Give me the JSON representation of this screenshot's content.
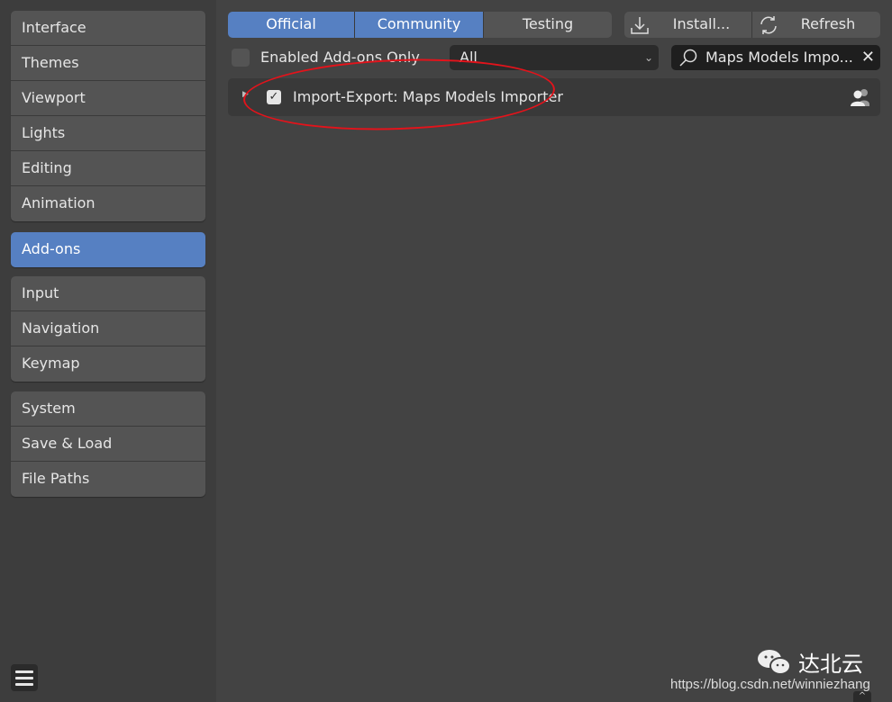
{
  "sidebar": {
    "groups": [
      [
        "Interface",
        "Themes",
        "Viewport",
        "Lights",
        "Editing",
        "Animation"
      ],
      [
        "Add-ons"
      ],
      [
        "Input",
        "Navigation",
        "Keymap"
      ],
      [
        "System",
        "Save & Load",
        "File Paths"
      ]
    ],
    "active": "Add-ons"
  },
  "tabs": {
    "official": "Official",
    "community": "Community",
    "testing": "Testing"
  },
  "actions": {
    "install": "Install...",
    "refresh": "Refresh"
  },
  "filter": {
    "enabled_only": "Enabled Add-ons Only",
    "category": "All",
    "search": "Maps Models Impo..."
  },
  "addon": {
    "name": "Import-Export: Maps Models Importer",
    "enabled": true
  },
  "watermark": {
    "brand": "达北云",
    "url": "https://blog.csdn.net/winniezhang"
  },
  "colors": {
    "accent": "#5680c2",
    "annotation": "#e3131b"
  }
}
